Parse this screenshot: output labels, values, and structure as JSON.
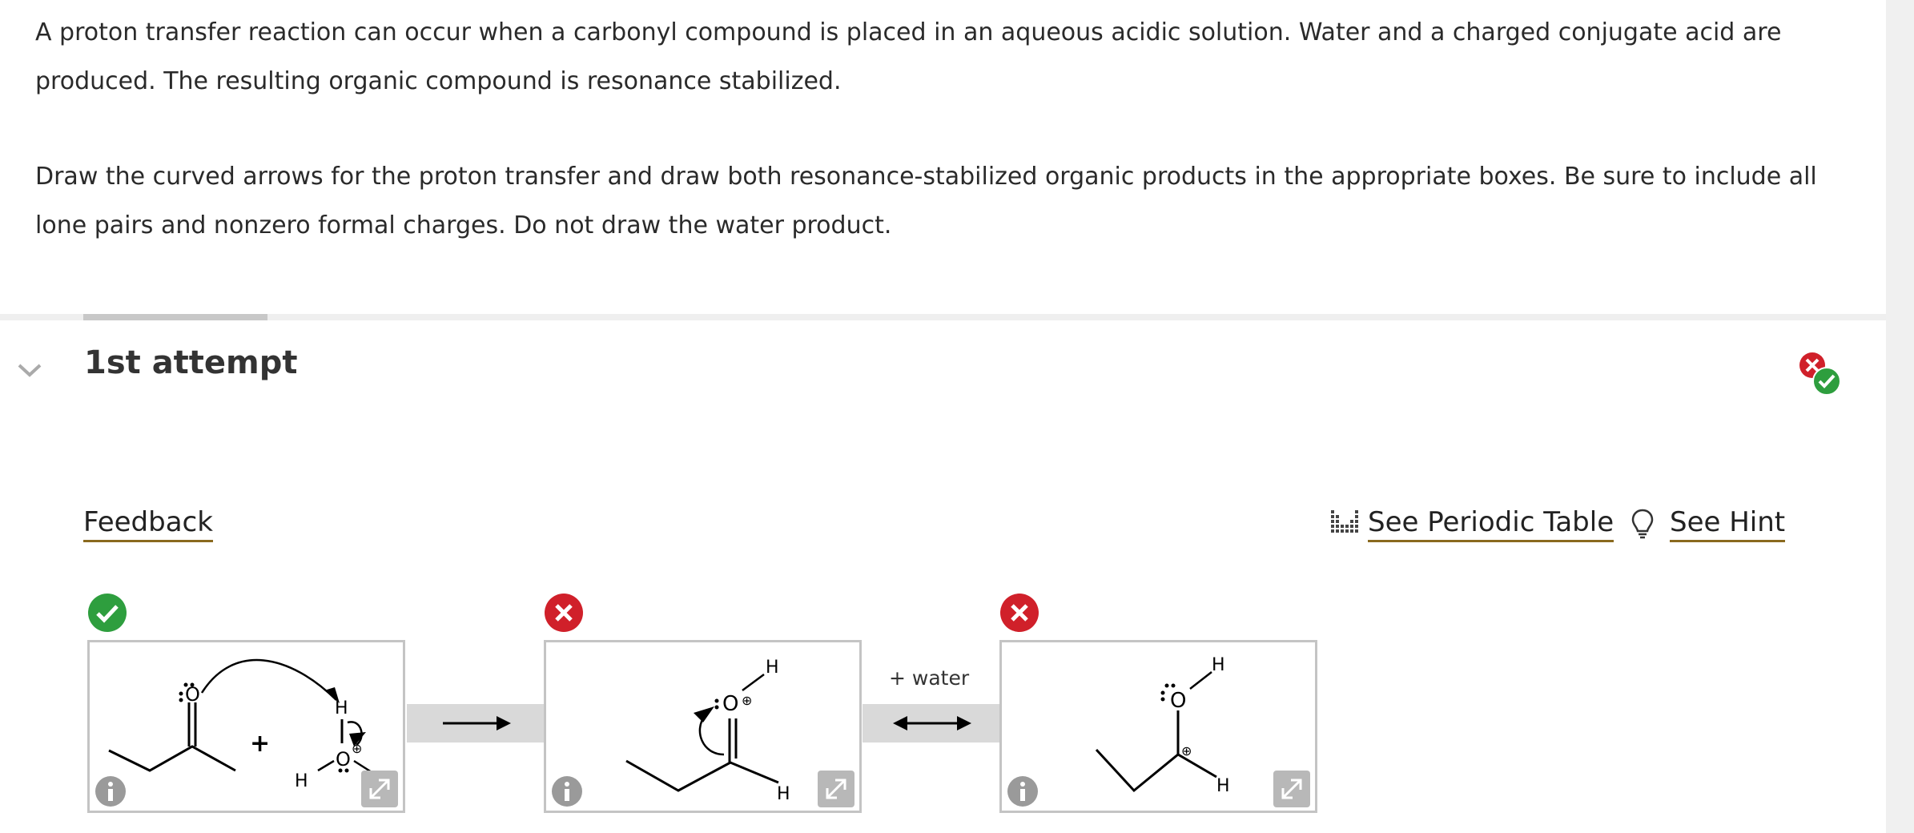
{
  "question": {
    "paragraph1": "A proton transfer reaction can occur when a carbonyl compound is placed in an aqueous acidic solution. Water and a charged conjugate acid are produced. The resulting organic compound is resonance stabilized.",
    "paragraph2": "Draw the curved arrows for the proton transfer and draw both resonance-stabilized organic products in the appropriate boxes. Be sure to include all lone pairs and nonzero formal charges. Do not draw the water product."
  },
  "attempt": {
    "title": "1st attempt"
  },
  "links": {
    "feedback": "Feedback",
    "periodic_table": "See Periodic Table",
    "hint": "See Hint"
  },
  "reaction": {
    "conjugate_label": "+ water",
    "boxes": [
      {
        "status": "correct",
        "plus": "+",
        "atoms": {
          "o1": "O",
          "h1": "H",
          "o2": "O",
          "h2": "H",
          "charge": "⊕"
        }
      },
      {
        "status": "incorrect",
        "atoms": {
          "o": "O",
          "h_top": "H",
          "h_bottom": "H",
          "charge": "⊕"
        }
      },
      {
        "status": "incorrect",
        "atoms": {
          "o": "O",
          "h_top": "H",
          "h_bottom": "H",
          "charge": "⊕"
        }
      }
    ]
  },
  "colors": {
    "correct": "#2e9e3e",
    "incorrect": "#d0202a",
    "link_underline": "#8a6a1f",
    "icon_gray": "#9a9a9a"
  }
}
